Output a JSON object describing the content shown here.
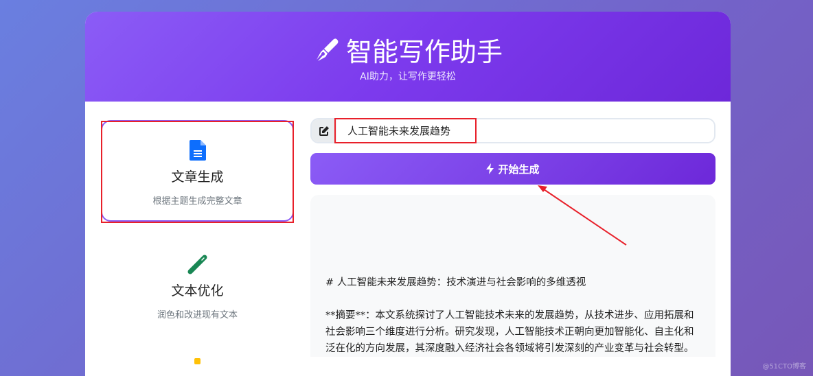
{
  "header": {
    "title": "智能写作助手",
    "subtitle": "AI助力，让写作更轻松"
  },
  "features": [
    {
      "name": "文章生成",
      "desc": "根据主题生成完整文章",
      "icon": "file-text-icon",
      "color": "#0d6efd"
    },
    {
      "name": "文本优化",
      "desc": "润色和改进现有文本",
      "icon": "magic-wand-icon",
      "color": "#198754"
    },
    {
      "icon": "lightbulb-icon",
      "color": "#ffc107"
    }
  ],
  "input": {
    "value": "人工智能未来发展趋势"
  },
  "generate_button": {
    "label": "开始生成"
  },
  "output": {
    "heading": "# 人工智能未来发展趋势：技术演进与社会影响的多维透视",
    "abstract": "**摘要**：本文系统探讨了人工智能技术未来的发展趋势，从技术进步、应用拓展和社会影响三个维度进行分析。研究发现，人工智能技术正朝向更加智能化、自主化和泛在化的方向发展，其深度融入经济社会各领域将引发深刻的产业变革与社会转型。"
  },
  "watermark": "@51CTO博客"
}
